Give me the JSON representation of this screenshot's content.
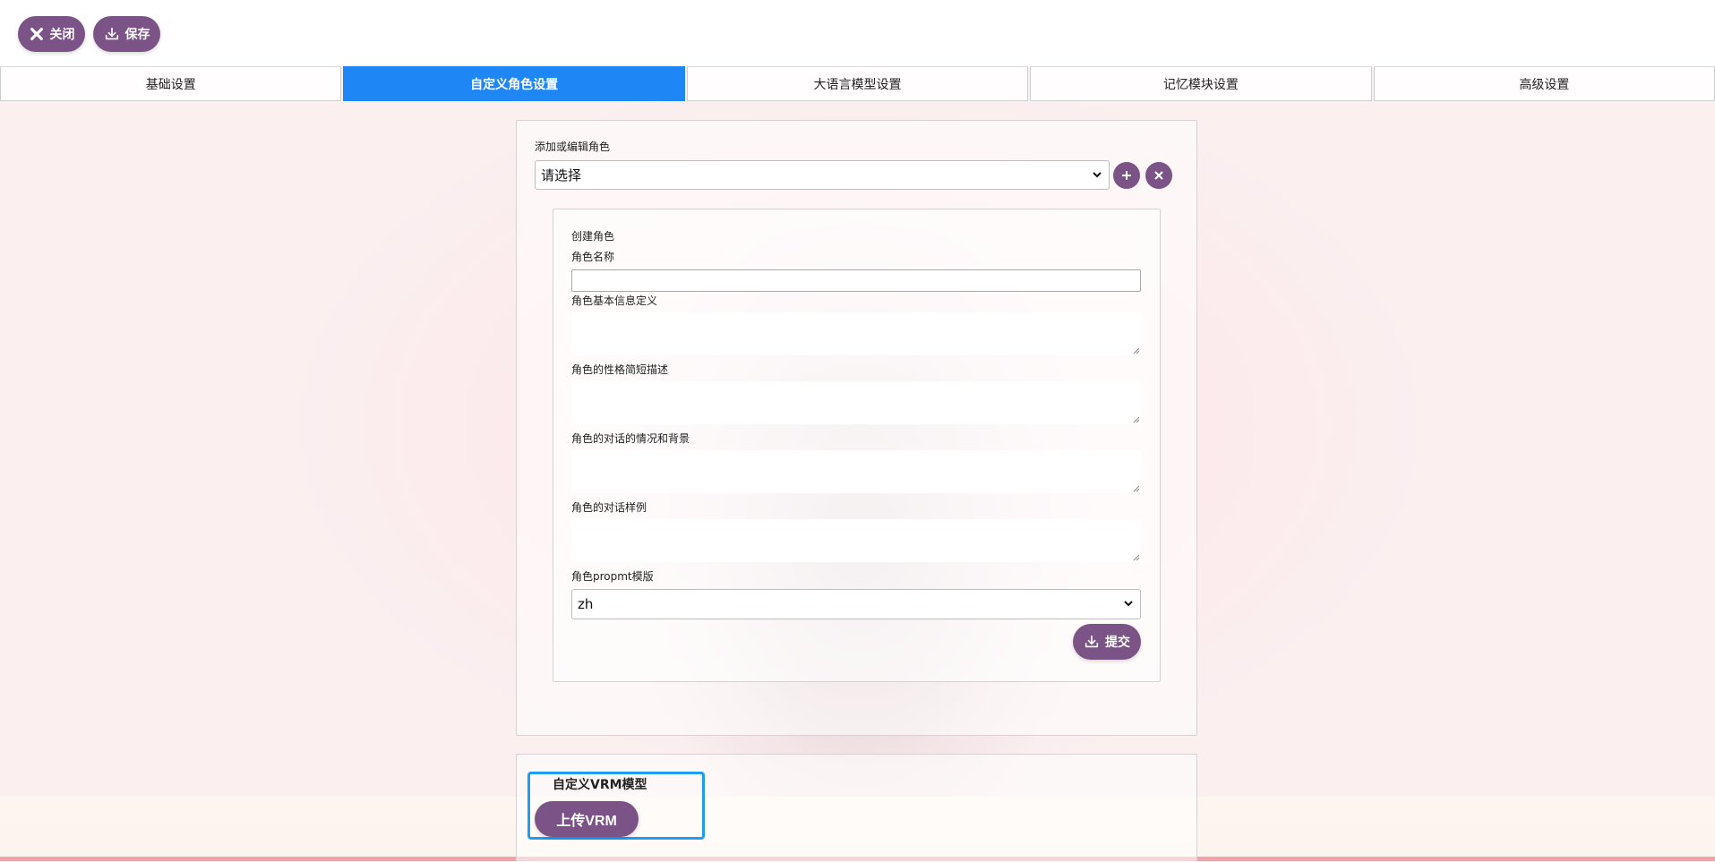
{
  "toolbar": {
    "close_label": "关闭",
    "save_label": "保存"
  },
  "tabs": [
    {
      "label": "基础设置",
      "active": false
    },
    {
      "label": "自定义角色设置",
      "active": true
    },
    {
      "label": "大语言模型设置",
      "active": false
    },
    {
      "label": "记忆模块设置",
      "active": false
    },
    {
      "label": "高级设置",
      "active": false
    }
  ],
  "character": {
    "section_label": "添加或编辑角色",
    "select_value": "请选择",
    "add_icon": "plus-icon",
    "delete_icon": "close-icon"
  },
  "create_form": {
    "title": "创建角色",
    "name_label": "角色名称",
    "name_value": "",
    "basic_info_label": "角色基本信息定义",
    "personality_label": "角色的性格简短描述",
    "scenario_label": "角色的对话的情况和背景",
    "examples_label": "角色的对话样例",
    "prompt_template_label": "角色propmt模版",
    "prompt_template_value": "zh",
    "submit_label": "提交"
  },
  "vrm": {
    "title": "自定义VRM模型",
    "upload_label": "上传VRM"
  },
  "colors": {
    "accent": "#7b5387",
    "active_tab": "#1e86f5",
    "highlight_border": "#1e9df2"
  }
}
